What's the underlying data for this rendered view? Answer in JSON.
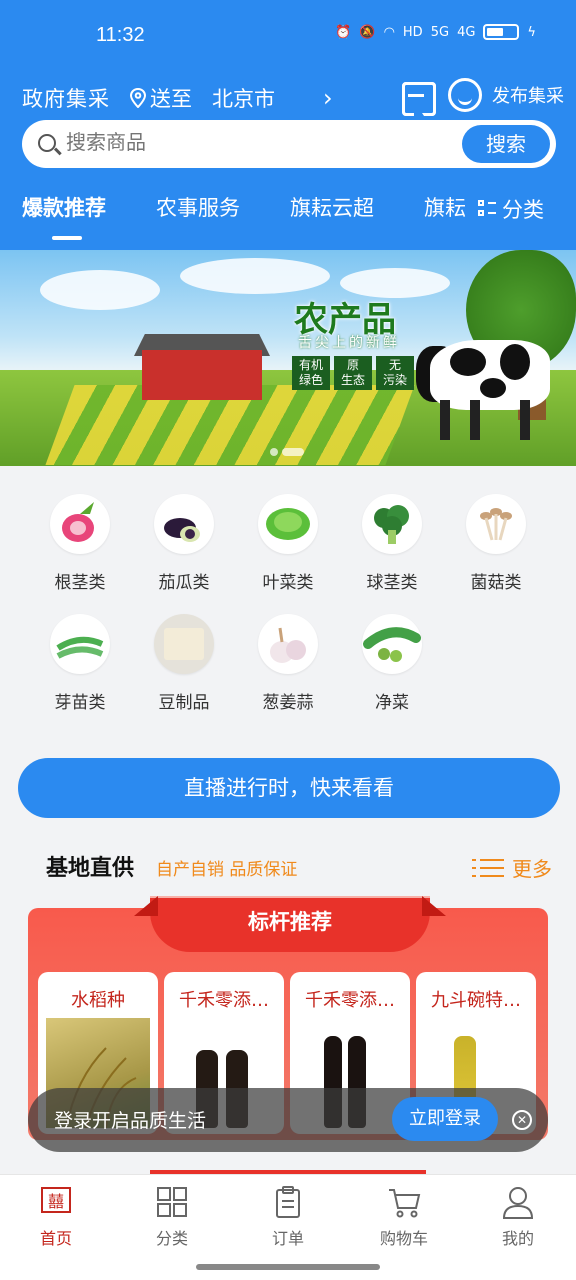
{
  "status_bar": {
    "time": "11:32",
    "hd": "HD",
    "net1": "5G",
    "net2": "4G"
  },
  "header": {
    "title": "政府集采",
    "location_prefix": "送至",
    "city": "北京市",
    "publish": "发布集采"
  },
  "search": {
    "placeholder": "搜索商品",
    "button": "搜索"
  },
  "tabs": [
    {
      "label": "爆款推荐",
      "active": true
    },
    {
      "label": "农事服务"
    },
    {
      "label": "旗耘云超"
    },
    {
      "label": "旗耘"
    }
  ],
  "category_button": "分类",
  "banner": {
    "title": "农产品",
    "subtitle": "舌尖上的新鲜",
    "tags": [
      {
        "line1": "有机",
        "line2": "绿色"
      },
      {
        "line1": "原",
        "line2": "生态"
      },
      {
        "line1": "无",
        "line2": "污染"
      }
    ],
    "slide_count": 2,
    "active_slide": 2
  },
  "categories": [
    {
      "label": "根茎类",
      "icon": "radish-icon"
    },
    {
      "label": "茄瓜类",
      "icon": "eggplant-icon"
    },
    {
      "label": "叶菜类",
      "icon": "lettuce-icon"
    },
    {
      "label": "球茎类",
      "icon": "broccoli-icon"
    },
    {
      "label": "菌菇类",
      "icon": "mushroom-icon"
    },
    {
      "label": "芽苗类",
      "icon": "peas-icon"
    },
    {
      "label": "豆制品",
      "icon": "tofu-icon"
    },
    {
      "label": "葱姜蒜",
      "icon": "garlic-icon"
    },
    {
      "label": "净菜",
      "icon": "green-peas-icon"
    }
  ],
  "live_banner": "直播进行时，快来看看",
  "section": {
    "title": "基地直供",
    "subtitle": "自产自销 品质保证",
    "more": "更多"
  },
  "featured": {
    "ribbon": "标杆推荐",
    "products": [
      {
        "name": "水稻种"
      },
      {
        "name": "千禾零添…"
      },
      {
        "name": "千禾零添…"
      },
      {
        "name": "九斗碗特…"
      }
    ]
  },
  "login_toast": {
    "text": "登录开启品质生活",
    "button": "立即登录"
  },
  "tabbar": [
    {
      "label": "首页",
      "icon": "home-logo-icon",
      "active": true
    },
    {
      "label": "分类",
      "icon": "grid-icon"
    },
    {
      "label": "订单",
      "icon": "clipboard-icon"
    },
    {
      "label": "购物车",
      "icon": "cart-icon"
    },
    {
      "label": "我的",
      "icon": "user-icon"
    }
  ],
  "colors": {
    "primary": "#2b8af0",
    "accent_orange": "#f08a1c",
    "brand_red": "#c4261d"
  }
}
